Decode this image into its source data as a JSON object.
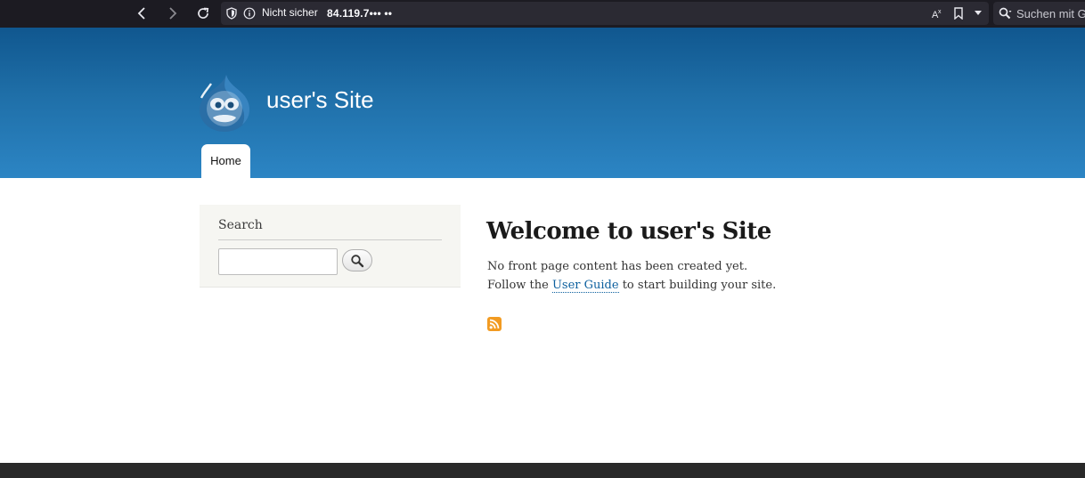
{
  "browser": {
    "security_label": "Nicht sicher",
    "url": "84.119.7••• ••",
    "search_placeholder": "Suchen mit G"
  },
  "site": {
    "name": "user's Site",
    "nav": [
      {
        "label": "Home"
      }
    ]
  },
  "sidebar": {
    "search_block_title": "Search",
    "search_value": ""
  },
  "main": {
    "title": "Welcome to user's Site",
    "line1": "No front page content has been created yet.",
    "line2_prefix": "Follow the ",
    "line2_link": "User Guide",
    "line2_suffix": " to start building your site."
  },
  "colors": {
    "header_top": "#10578f",
    "header_bottom": "#2c85c4",
    "link": "#0b5f9e",
    "rss": "#f29b22",
    "footer": "#292929"
  }
}
